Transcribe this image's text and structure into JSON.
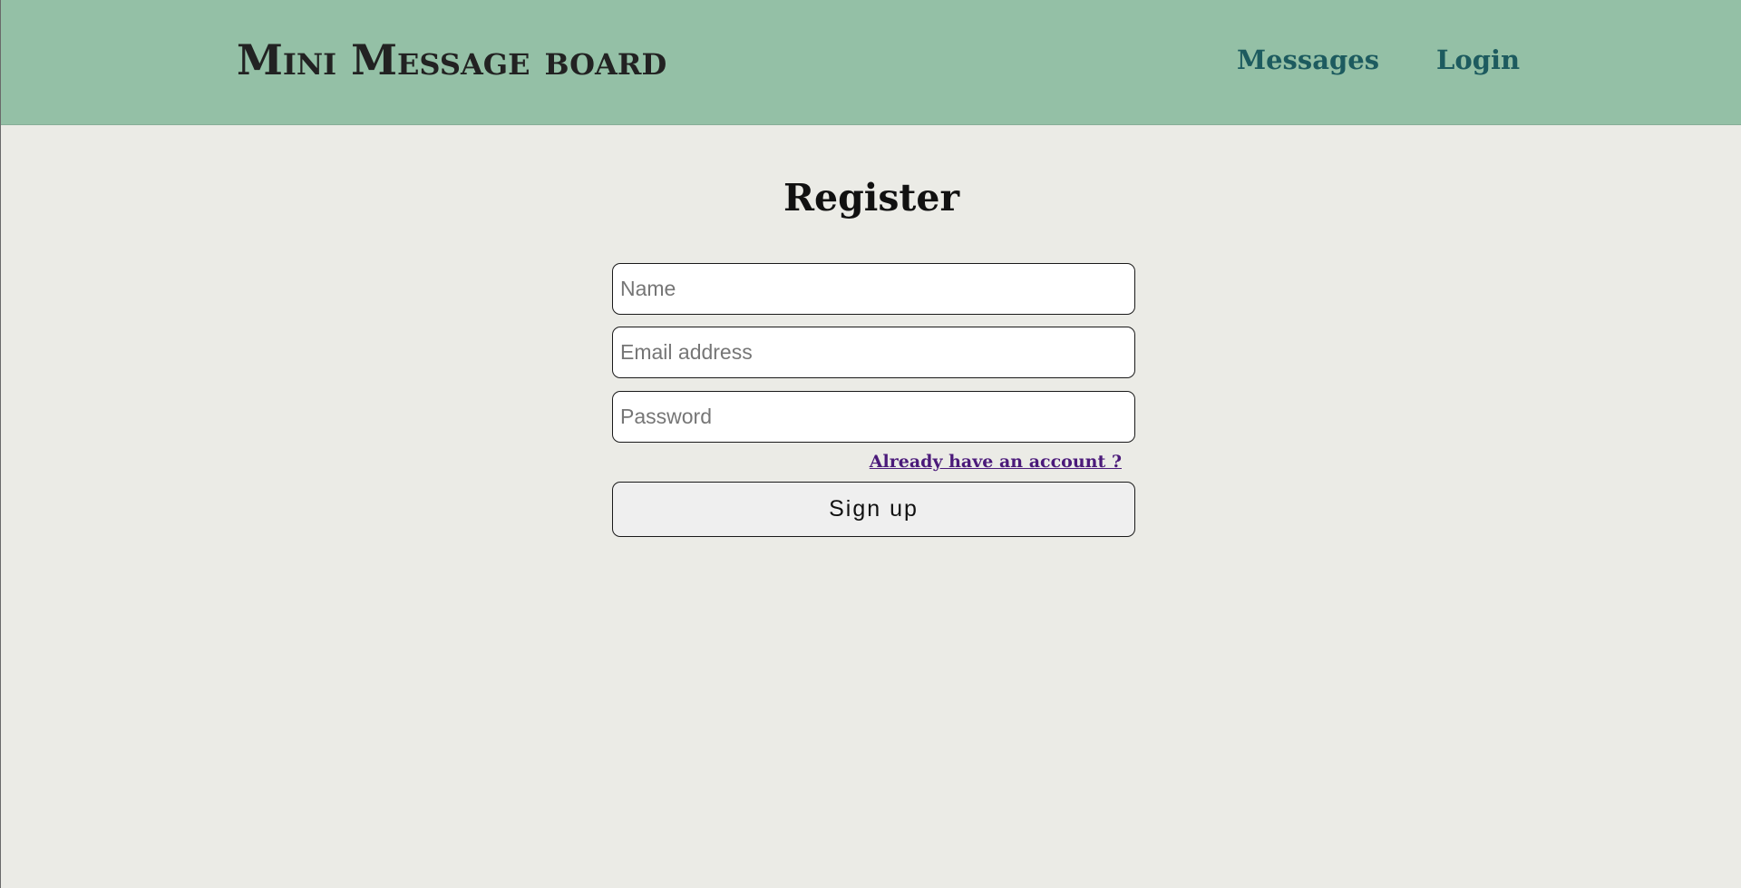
{
  "header": {
    "logo_text": "Mini Message board",
    "nav": {
      "messages_label": "Messages",
      "login_label": "Login"
    },
    "colors": {
      "background": "#94c0a6",
      "nav_link": "#1d5b5f"
    }
  },
  "register_form": {
    "title": "Register",
    "name_field": {
      "placeholder": "Name",
      "value": ""
    },
    "email_field": {
      "placeholder": "Email address",
      "value": ""
    },
    "password_field": {
      "placeholder": "Password",
      "value": ""
    },
    "account_link_label": "Already have an account ?",
    "submit_label": "Sign up"
  },
  "page": {
    "background": "#ebebe6"
  }
}
